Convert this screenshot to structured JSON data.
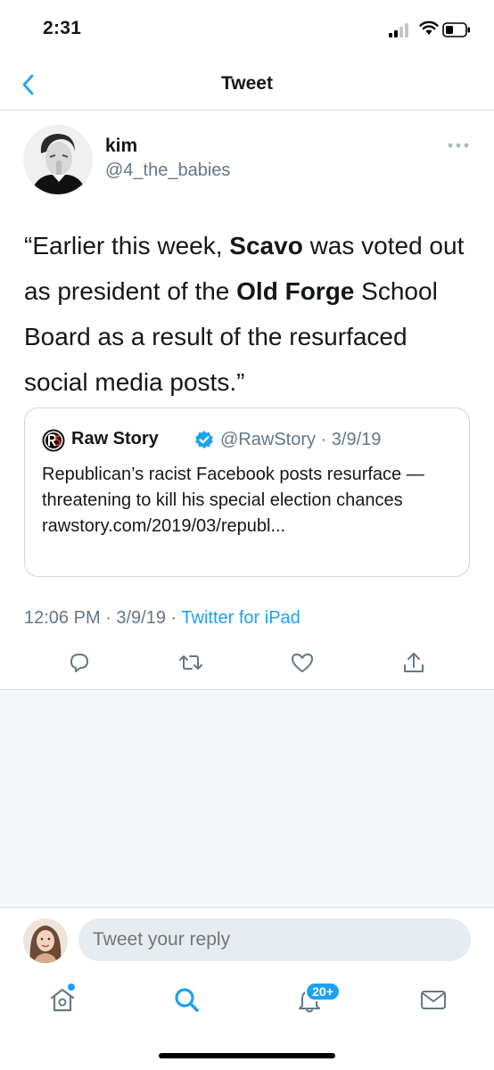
{
  "status_bar": {
    "time": "2:31"
  },
  "header": {
    "title": "Tweet"
  },
  "tweet": {
    "author_name": "kim",
    "author_handle": "@4_the_babies",
    "text_parts": [
      "“Earlier this week, ",
      "Scavo",
      " was voted out as president of the ",
      "Old Forge",
      " School Board as a result of the resurfaced social media posts.”"
    ],
    "quote": {
      "name": "Raw Story",
      "meta": "@RawStory · 3/9/19",
      "body": "Republican’s racist Facebook posts resurface — threatening to kill his special election chances rawstory.com/2019/03/republ..."
    },
    "timestamp": "12:06 PM · 3/9/19 · ",
    "source": "Twitter for iPad"
  },
  "reply": {
    "placeholder": "Tweet your reply"
  },
  "tabs": {
    "notifications_badge": "20+"
  },
  "colors": {
    "accent": "#1da1f2",
    "secondary_text": "#657786",
    "divider": "#d6dbe0",
    "background_muted": "#f5f8fa"
  }
}
